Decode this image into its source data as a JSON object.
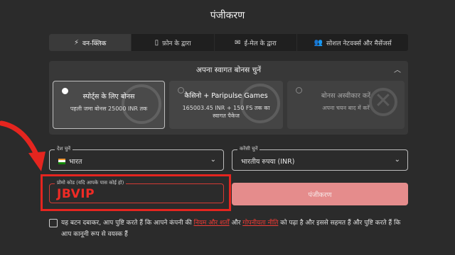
{
  "page": {
    "title": "पंजीकरण"
  },
  "tabs": [
    {
      "label": "वन-क्लिक",
      "icon": "lightning-icon"
    },
    {
      "label": "फ़ोन के द्वारा",
      "icon": "phone-icon"
    },
    {
      "label": "ई-मेल के द्वारा",
      "icon": "envelope-icon"
    },
    {
      "label": "सोशल नेटवर्क्स और मैसेंजर्स",
      "icon": "people-icon"
    }
  ],
  "active_tab": 0,
  "bonus": {
    "heading": "अपना स्वागत बोनस चुनें",
    "cards": [
      {
        "title": "स्पोर्ट्स के लिए बोनस",
        "subtitle": "पहली जमा बोनस 25000 INR तक",
        "selected": true
      },
      {
        "title": "कैसिनो + Paripulse Games",
        "subtitle": "165003.45 INR + 150 FS तक का स्वागत पैकेज",
        "selected": false
      },
      {
        "title": "बोनस अस्वीकार करें",
        "subtitle": "अपना चयन बाद में करें",
        "selected": false
      }
    ]
  },
  "country": {
    "label": "देश चुनें",
    "value": "भारत"
  },
  "currency": {
    "label": "करेंसी चुनें",
    "value": "भारतीय रुपया (INR)"
  },
  "promo": {
    "label": "प्रोमो कोड (यदि आपके पास कोई हो)",
    "value": "JBVIP"
  },
  "submit": {
    "label": "पंजीकरण"
  },
  "terms": {
    "part1": "यह बटन दबाकर, आप पुष्टि करते हैं कि आपने कंपनी की ",
    "link1": "नियम और शर्तों",
    "part2": " और ",
    "link2": "गोपनीयता नीति",
    "part3": " को पढ़ा है और इससे सहमत हैं और पुष्टि करते हैं कि आप कानूनी रूप से वयस्क हैं"
  },
  "colors": {
    "accent": "#e5251f",
    "button": "#e58c8c",
    "background": "#2b2b2b"
  }
}
